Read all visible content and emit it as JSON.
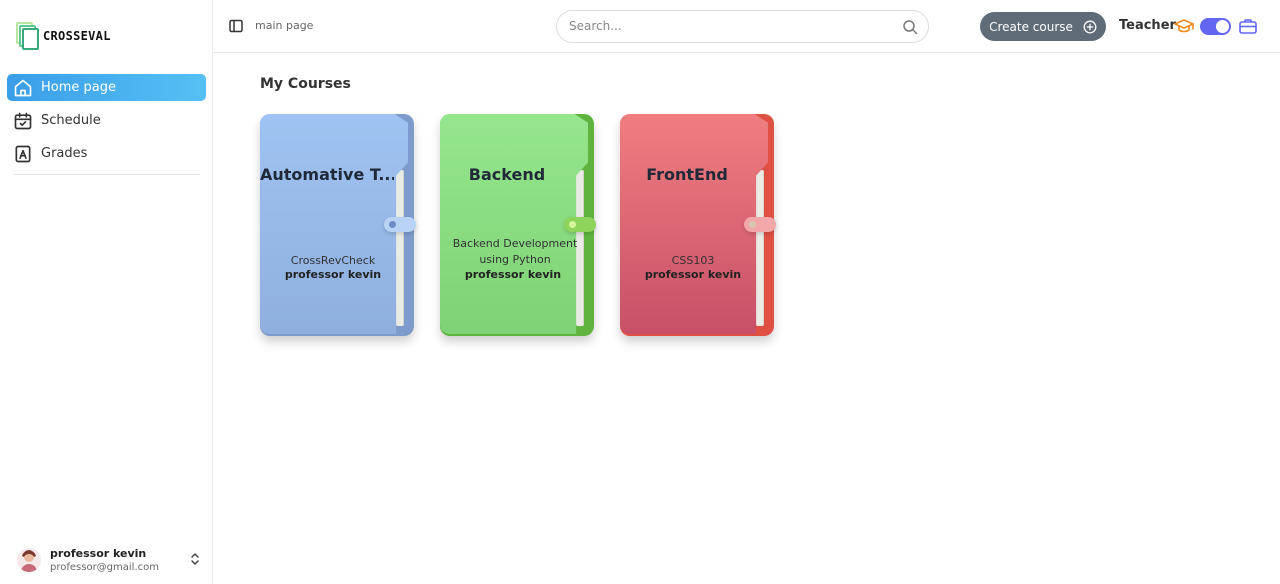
{
  "app": {
    "logo_text": "CROSSEVAL"
  },
  "sidebar": {
    "items": [
      {
        "label": "Home page",
        "icon": "home-icon",
        "active": true
      },
      {
        "label": "Schedule",
        "icon": "calendar-check-icon",
        "active": false
      },
      {
        "label": "Grades",
        "icon": "grades-icon",
        "active": false
      }
    ],
    "user": {
      "name": "professor kevin",
      "email": "professor@gmail.com"
    }
  },
  "header": {
    "breadcrumb": "main page",
    "search": {
      "placeholder": "Search...",
      "value": ""
    },
    "create_button": "Create course",
    "role_label": "Teacher",
    "role_toggle_on": true
  },
  "main": {
    "section_title": "My Courses",
    "courses": [
      {
        "title": "Automative T...",
        "description": "CrossRevCheck",
        "teacher": "professor kevin",
        "color": "#9fc3f2"
      },
      {
        "title": "Backend",
        "description": "Backend Development using Python",
        "teacher": "professor kevin",
        "color": "#95e68e"
      },
      {
        "title": "FrontEnd",
        "description": "CSS103",
        "teacher": "professor kevin",
        "color": "#f07e80"
      }
    ]
  },
  "colors": {
    "accent": "#3a9ee8",
    "toggle": "#6366f1",
    "create_button": "#5f6b77"
  }
}
